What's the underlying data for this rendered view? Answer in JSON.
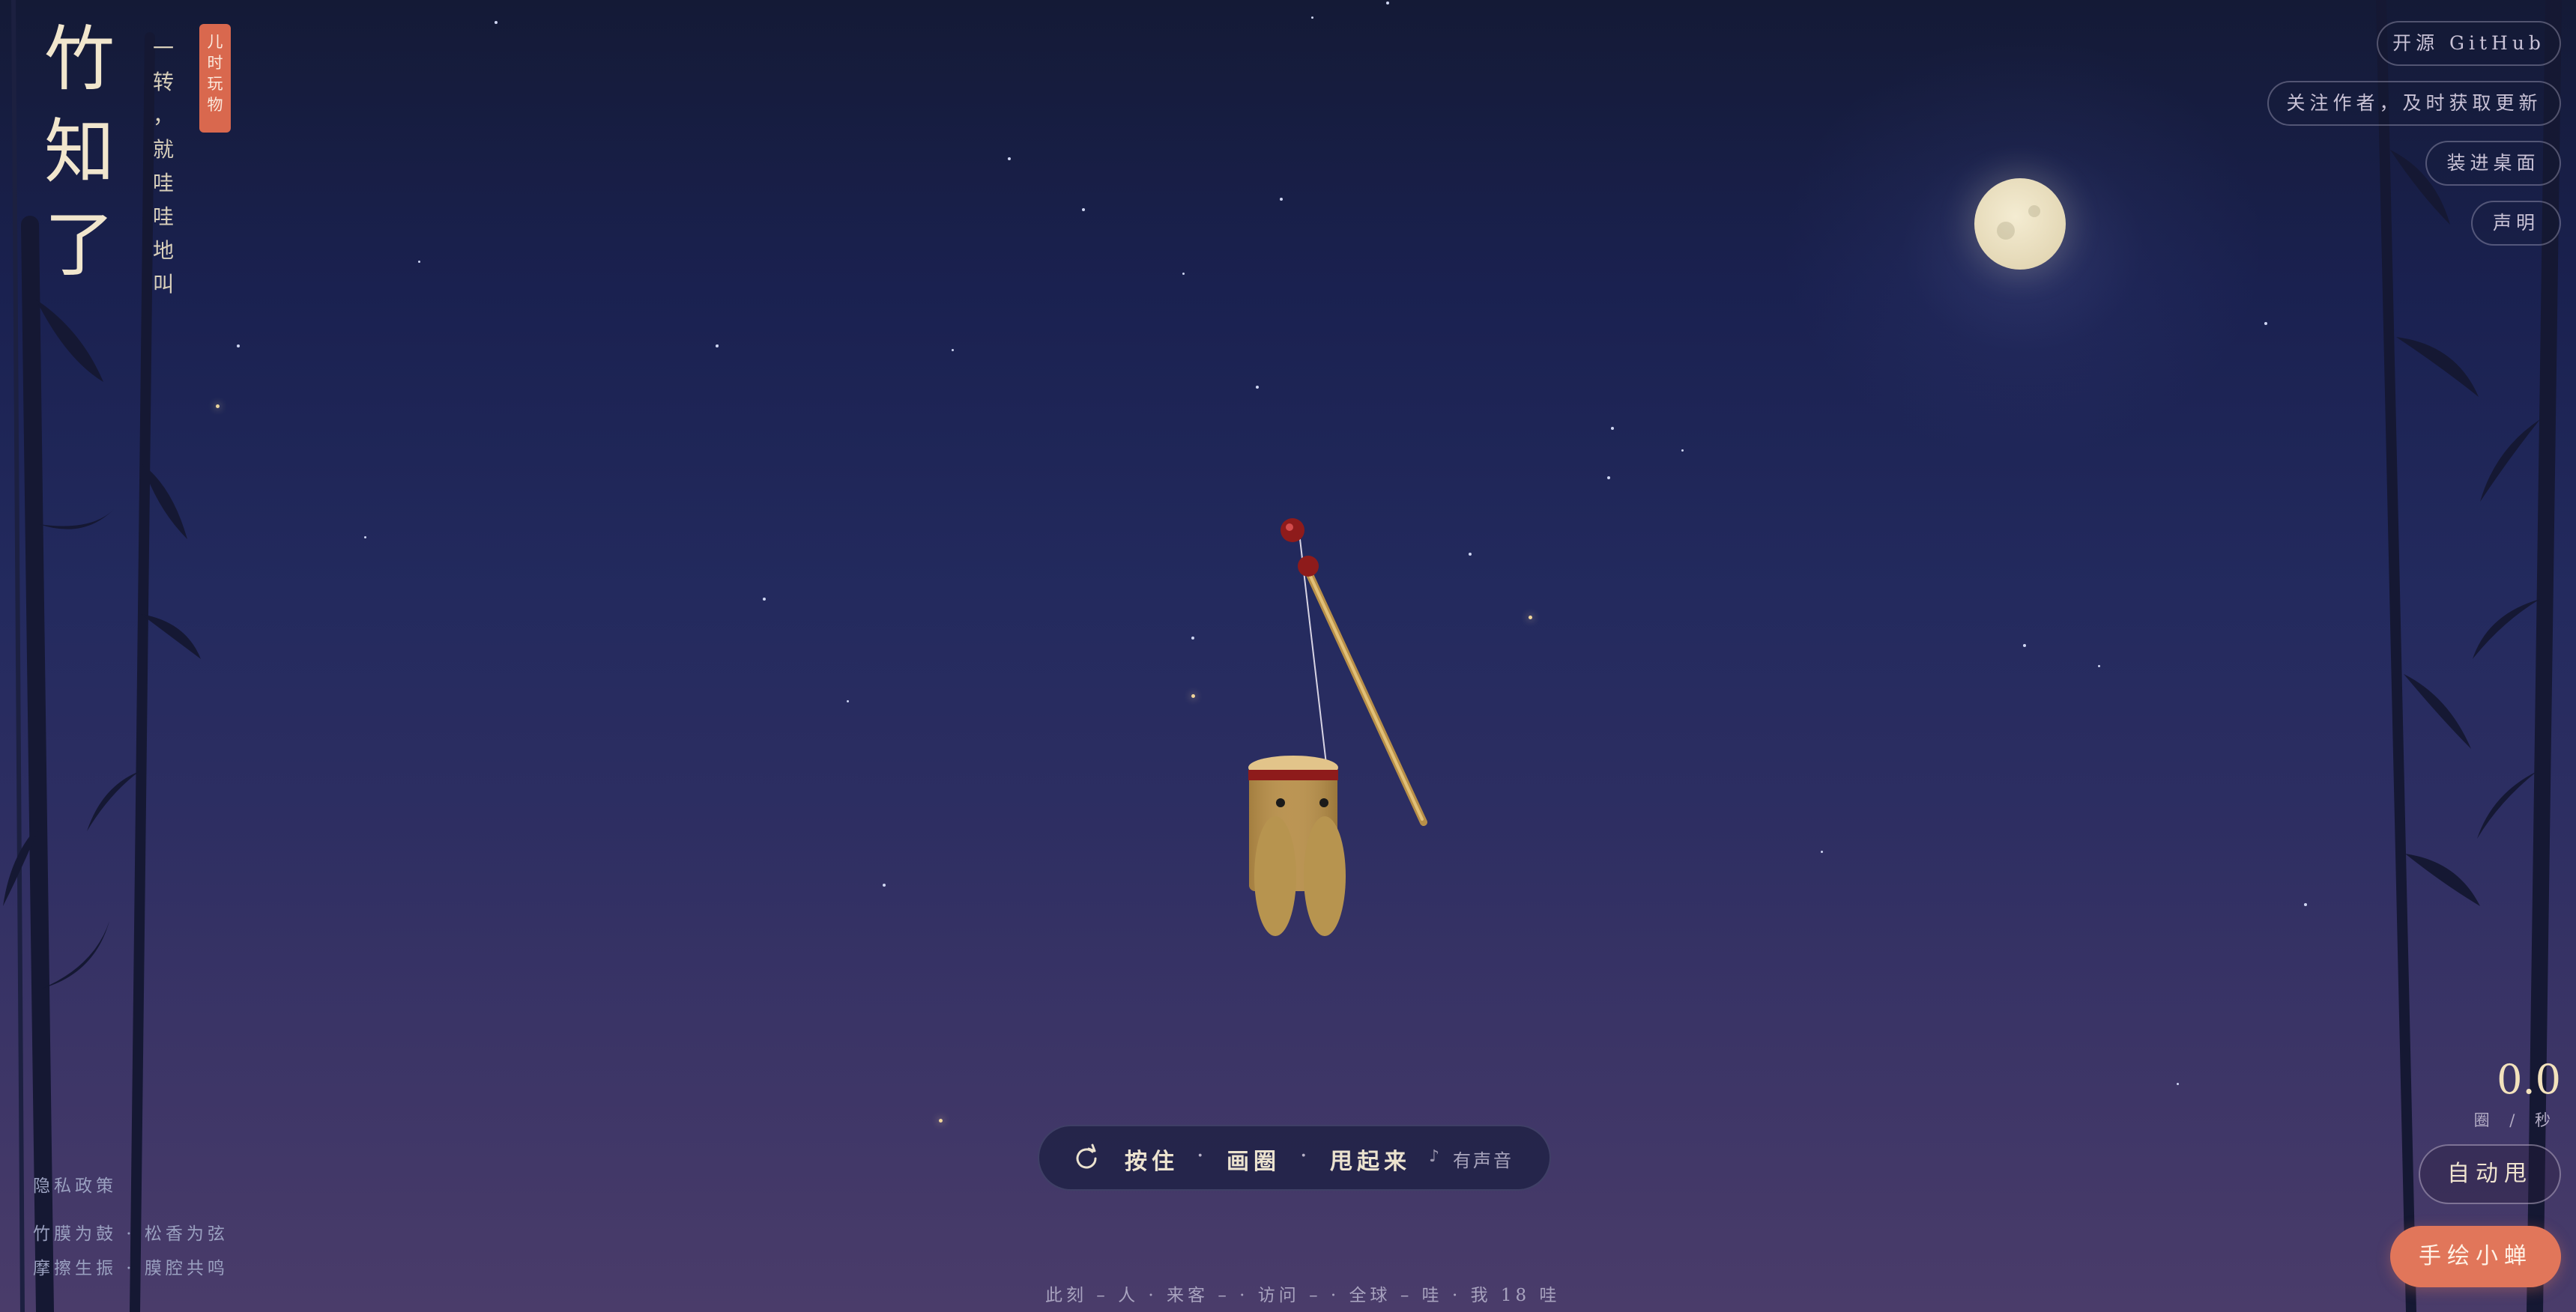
{
  "app": {
    "title_chars": [
      "竹",
      "知",
      "了"
    ],
    "subtitle_chars": [
      "一",
      "转",
      "，",
      "就",
      "哇",
      "哇",
      "地",
      "叫"
    ],
    "seal_chars": [
      "儿",
      "时",
      "玩",
      "物"
    ]
  },
  "top_right": {
    "github": "开源 GitHub",
    "follow": "关注作者，及时获取更新",
    "desktop": "装进桌面",
    "statement": "声明"
  },
  "footer_left": {
    "privacy": "隐私政策",
    "line1": "竹膜为鼓 · 松香为弦",
    "line2": "摩擦生振 · 膜腔共鸣"
  },
  "control": {
    "icon": "rotate-icon",
    "step1": "按住",
    "step2": "画圈",
    "step3": "甩起来",
    "sep": "·",
    "sound": "有声音"
  },
  "stats": "此刻 – 人 · 来客 – · 访问 – · 全球 – 哇 · 我 18 哇",
  "rate": {
    "value": "0.0",
    "unit": "圈 / 秒"
  },
  "actions": {
    "auto": "自动甩",
    "draw": "手绘小蝉"
  },
  "colors": {
    "seal": "#d9684e",
    "draw_button": "#e1765a",
    "moon": "#efe6cc",
    "rate": "#f3e2bc"
  }
}
